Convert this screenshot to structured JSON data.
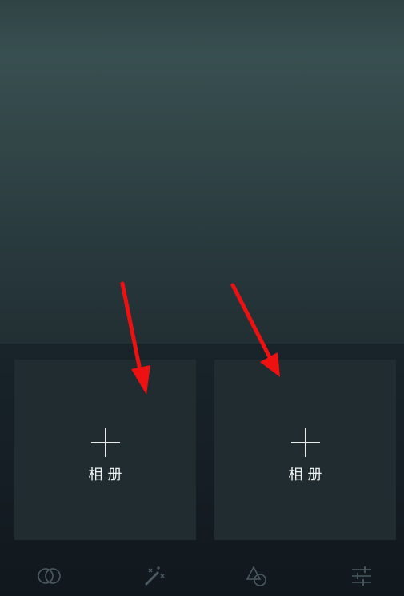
{
  "slots": [
    {
      "label": "相册",
      "icon": "plus-icon"
    },
    {
      "label": "相册",
      "icon": "plus-icon"
    }
  ],
  "tabbar": {
    "items": [
      {
        "icon": "overlap-circles-icon"
      },
      {
        "icon": "magic-wand-icon"
      },
      {
        "icon": "shapes-icon"
      },
      {
        "icon": "sliders-icon"
      }
    ]
  },
  "colors": {
    "background_top": "#384f50",
    "panel": "#141d23",
    "slot": "#212c31",
    "arrow": "#ee1111",
    "icon": "#4a5a60"
  }
}
